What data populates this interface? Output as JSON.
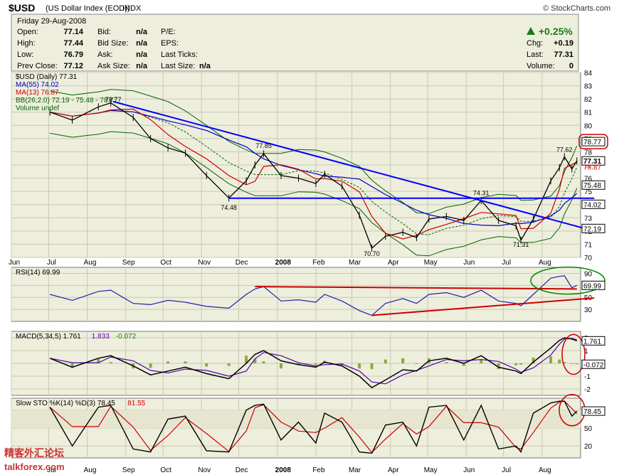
{
  "header": {
    "symbol": "$USD",
    "name": "(US Dollar Index (EOD))",
    "exchange": "INDX",
    "source": "© StockCharts.com"
  },
  "quote": {
    "date": "Friday   29-Aug-2008",
    "rows": [
      [
        "Open:",
        "77.14",
        "Bid:",
        "n/a",
        "P/E:",
        ""
      ],
      [
        "High:",
        "77.44",
        "Bid Size:",
        "n/a",
        "EPS:",
        ""
      ],
      [
        "Low:",
        "76.79",
        "Ask:",
        "n/a",
        "Last Ticks:",
        ""
      ],
      [
        "Prev Close:",
        "77.12",
        "Ask Size:",
        "n/a",
        "Last Size:",
        "n/a"
      ]
    ],
    "change_pct": "+0.25%",
    "right": [
      [
        "Chg:",
        "+0.19"
      ],
      [
        "Last:",
        "77.31"
      ],
      [
        "Volume:",
        "0"
      ]
    ],
    "up_color": "#1a7a1a"
  },
  "watermark": {
    "chinese": "精客外汇论坛",
    "url": "talkforex.com"
  },
  "chart_data": [
    {
      "type": "line",
      "panel": "price",
      "legend": [
        {
          "text": "$USD (Daily) 77.31",
          "color": "#000000"
        },
        {
          "text": "MA(55) 74.02",
          "color": "#0000cc"
        },
        {
          "text": "MA(13) 76.87",
          "color": "#cc0000"
        },
        {
          "text": "BB(26,2.0) 72.19 - 75.48 - 78.77",
          "color": "#006600"
        },
        {
          "text": "Volume undef",
          "color": "#006600"
        }
      ],
      "ylim": [
        70,
        84
      ],
      "y_ticks": [
        "70",
        "71",
        "72",
        "73",
        "74",
        "75",
        "76",
        "77",
        "78",
        "79",
        "80",
        "81",
        "82",
        "83",
        "84"
      ],
      "x_labels": [
        "Jun",
        "Jul",
        "Aug",
        "Sep",
        "Oct",
        "Nov",
        "Dec",
        "2008",
        "Feb",
        "Mar",
        "Apr",
        "May",
        "Jun",
        "Jul",
        "Aug"
      ],
      "price_series": [
        {
          "date": "2007-07-02",
          "value": 81.0
        },
        {
          "date": "2007-07-20",
          "value": 80.4
        },
        {
          "date": "2007-08-10",
          "value": 81.4
        },
        {
          "date": "2007-08-20",
          "value": 81.7
        },
        {
          "date": "2007-09-07",
          "value": 80.6
        },
        {
          "date": "2007-09-21",
          "value": 79.0
        },
        {
          "date": "2007-10-05",
          "value": 78.3
        },
        {
          "date": "2007-10-19",
          "value": 77.9
        },
        {
          "date": "2007-11-05",
          "value": 76.2
        },
        {
          "date": "2007-11-23",
          "value": 74.5
        },
        {
          "date": "2007-12-07",
          "value": 75.8
        },
        {
          "date": "2007-12-14",
          "value": 77.0
        },
        {
          "date": "2007-12-21",
          "value": 77.85
        },
        {
          "date": "2008-01-04",
          "value": 76.2
        },
        {
          "date": "2008-01-18",
          "value": 76.0
        },
        {
          "date": "2008-02-01",
          "value": 75.6
        },
        {
          "date": "2008-02-08",
          "value": 76.3
        },
        {
          "date": "2008-02-22",
          "value": 75.4
        },
        {
          "date": "2008-03-07",
          "value": 73.2
        },
        {
          "date": "2008-03-17",
          "value": 70.7
        },
        {
          "date": "2008-03-28",
          "value": 71.6
        },
        {
          "date": "2008-04-11",
          "value": 71.9
        },
        {
          "date": "2008-04-22",
          "value": 71.5
        },
        {
          "date": "2008-05-02",
          "value": 72.9
        },
        {
          "date": "2008-05-16",
          "value": 73.1
        },
        {
          "date": "2008-05-30",
          "value": 72.8
        },
        {
          "date": "2008-06-13",
          "value": 74.31
        },
        {
          "date": "2008-06-27",
          "value": 72.8
        },
        {
          "date": "2008-07-11",
          "value": 72.4
        },
        {
          "date": "2008-07-15",
          "value": 71.31
        },
        {
          "date": "2008-07-25",
          "value": 72.9
        },
        {
          "date": "2008-08-08",
          "value": 75.8
        },
        {
          "date": "2008-08-15",
          "value": 76.8
        },
        {
          "date": "2008-08-19",
          "value": 77.62
        },
        {
          "date": "2008-08-25",
          "value": 76.7
        },
        {
          "date": "2008-08-29",
          "value": 77.31
        }
      ],
      "annotations": [
        {
          "text": "78.77",
          "date": "2007-08-22",
          "value": 81.8
        },
        {
          "text": "77.85",
          "date": "2007-12-21",
          "value": 78.3
        },
        {
          "text": "74.48",
          "date": "2007-11-23",
          "value": 73.6
        },
        {
          "text": "74.31",
          "date": "2008-06-13",
          "value": 74.7
        },
        {
          "text": "70.70",
          "date": "2008-03-17",
          "value": 70.1
        },
        {
          "text": "71.31",
          "date": "2008-07-15",
          "value": 70.8
        },
        {
          "text": "77.62",
          "date": "2008-08-19",
          "value": 78.0
        }
      ],
      "price_labels": [
        {
          "text": "78.77",
          "value": 78.77,
          "border": "#000000"
        },
        {
          "text": "77.31",
          "value": 77.31,
          "border": "#000000"
        },
        {
          "text": "76.87",
          "value": 76.87,
          "border": "none"
        },
        {
          "text": "75.48",
          "value": 75.48,
          "border": "#000000"
        },
        {
          "text": "74.02",
          "value": 74.02,
          "border": "#000000"
        },
        {
          "text": "72.19",
          "value": 72.19,
          "border": "#000000"
        }
      ],
      "trendlines": [
        {
          "from_date": "2007-08-22",
          "from_value": 81.8,
          "to_date": "2008-09-12",
          "to_value": 72.0,
          "color": "#0000ff"
        },
        {
          "from_date": "2007-11-23",
          "from_value": 74.48,
          "to_date": "2008-09-12",
          "to_value": 74.48,
          "color": "#0000ff"
        }
      ]
    },
    {
      "type": "line",
      "panel": "rsi",
      "legend": [
        {
          "text": "RSI(14) 69.99",
          "color": "#000000"
        }
      ],
      "ylim": [
        10,
        100
      ],
      "y_ticks": [
        "30",
        "50",
        "70",
        "90"
      ],
      "current_label": "69.99",
      "current_value": 69.99,
      "series": [
        {
          "date": "2007-07-02",
          "value": 55
        },
        {
          "date": "2007-07-20",
          "value": 45
        },
        {
          "date": "2007-08-10",
          "value": 60
        },
        {
          "date": "2007-08-20",
          "value": 62
        },
        {
          "date": "2007-09-07",
          "value": 40
        },
        {
          "date": "2007-09-21",
          "value": 38
        },
        {
          "date": "2007-10-05",
          "value": 45
        },
        {
          "date": "2007-10-19",
          "value": 42
        },
        {
          "date": "2007-11-05",
          "value": 35
        },
        {
          "date": "2007-11-23",
          "value": 32
        },
        {
          "date": "2007-12-07",
          "value": 55
        },
        {
          "date": "2007-12-14",
          "value": 64
        },
        {
          "date": "2007-12-21",
          "value": 68
        },
        {
          "date": "2008-01-04",
          "value": 44
        },
        {
          "date": "2008-01-18",
          "value": 46
        },
        {
          "date": "2008-02-01",
          "value": 42
        },
        {
          "date": "2008-02-08",
          "value": 55
        },
        {
          "date": "2008-02-22",
          "value": 44
        },
        {
          "date": "2008-03-07",
          "value": 28
        },
        {
          "date": "2008-03-17",
          "value": 20
        },
        {
          "date": "2008-03-28",
          "value": 40
        },
        {
          "date": "2008-04-11",
          "value": 48
        },
        {
          "date": "2008-04-22",
          "value": 40
        },
        {
          "date": "2008-05-02",
          "value": 55
        },
        {
          "date": "2008-05-16",
          "value": 58
        },
        {
          "date": "2008-05-30",
          "value": 50
        },
        {
          "date": "2008-06-13",
          "value": 62
        },
        {
          "date": "2008-06-27",
          "value": 44
        },
        {
          "date": "2008-07-11",
          "value": 40
        },
        {
          "date": "2008-07-15",
          "value": 36
        },
        {
          "date": "2008-07-25",
          "value": 55
        },
        {
          "date": "2008-08-08",
          "value": 82
        },
        {
          "date": "2008-08-15",
          "value": 85
        },
        {
          "date": "2008-08-19",
          "value": 86
        },
        {
          "date": "2008-08-25",
          "value": 66
        },
        {
          "date": "2008-08-29",
          "value": 69.99
        }
      ],
      "trendlines": [
        {
          "from_date": "2007-12-14",
          "from_value": 68,
          "to_date": "2008-08-29",
          "to_value": 64,
          "color": "#cc0000"
        },
        {
          "from_date": "2008-03-17",
          "from_value": 20,
          "to_date": "2008-09-12",
          "to_value": 49,
          "color": "#cc0000"
        }
      ]
    },
    {
      "type": "line",
      "panel": "macd",
      "legend": [
        {
          "text": "MACD(5,34,5) 1.761",
          "color": "#000000"
        },
        {
          "text": "1.833",
          "color": "#5500aa"
        },
        {
          "text": "-0.072",
          "color": "#008800"
        }
      ],
      "ylim": [
        -2.5,
        2.5
      ],
      "y_ticks": [
        "-2",
        "-1",
        "0",
        "1",
        "2"
      ],
      "current_labels": [
        {
          "text": "1.761",
          "value": 1.761
        },
        {
          "text": "-0.072",
          "value": -0.072
        }
      ],
      "series": [
        {
          "date": "2007-07-02",
          "value": 0.4
        },
        {
          "date": "2007-07-20",
          "value": -0.3
        },
        {
          "date": "2007-08-10",
          "value": 0.4
        },
        {
          "date": "2007-08-20",
          "value": 0.6
        },
        {
          "date": "2007-09-07",
          "value": -0.2
        },
        {
          "date": "2007-09-21",
          "value": -0.9
        },
        {
          "date": "2007-10-05",
          "value": -0.6
        },
        {
          "date": "2007-10-19",
          "value": -0.3
        },
        {
          "date": "2007-11-05",
          "value": -0.8
        },
        {
          "date": "2007-11-23",
          "value": -1.2
        },
        {
          "date": "2007-12-07",
          "value": 0.0
        },
        {
          "date": "2007-12-14",
          "value": 0.7
        },
        {
          "date": "2007-12-21",
          "value": 1.0
        },
        {
          "date": "2008-01-04",
          "value": 0.2
        },
        {
          "date": "2008-01-18",
          "value": -0.1
        },
        {
          "date": "2008-02-01",
          "value": -0.3
        },
        {
          "date": "2008-02-08",
          "value": 0.1
        },
        {
          "date": "2008-02-22",
          "value": -0.2
        },
        {
          "date": "2008-03-07",
          "value": -1.0
        },
        {
          "date": "2008-03-17",
          "value": -1.9
        },
        {
          "date": "2008-03-28",
          "value": -1.3
        },
        {
          "date": "2008-04-11",
          "value": -0.5
        },
        {
          "date": "2008-04-22",
          "value": -0.6
        },
        {
          "date": "2008-05-02",
          "value": 0.2
        },
        {
          "date": "2008-05-16",
          "value": 0.4
        },
        {
          "date": "2008-05-30",
          "value": 0.0
        },
        {
          "date": "2008-06-13",
          "value": 0.6
        },
        {
          "date": "2008-06-27",
          "value": -0.3
        },
        {
          "date": "2008-07-11",
          "value": -0.6
        },
        {
          "date": "2008-07-15",
          "value": -0.8
        },
        {
          "date": "2008-07-25",
          "value": 0.1
        },
        {
          "date": "2008-08-08",
          "value": 1.2
        },
        {
          "date": "2008-08-15",
          "value": 1.8
        },
        {
          "date": "2008-08-19",
          "value": 2.0
        },
        {
          "date": "2008-08-25",
          "value": 1.9
        },
        {
          "date": "2008-08-29",
          "value": 1.761
        }
      ]
    },
    {
      "type": "line",
      "panel": "stochastic",
      "legend": [
        {
          "text": "Slow STO %K(14) %D(3) 78.45",
          "color": "#000000"
        },
        {
          "text": "81.55",
          "color": "#cc0000"
        }
      ],
      "ylim": [
        0,
        100
      ],
      "y_ticks": [
        "20",
        "50",
        "80"
      ],
      "current_label": "78.45",
      "current_value": 78.45,
      "series": [
        {
          "date": "2007-07-02",
          "value": 85
        },
        {
          "date": "2007-07-20",
          "value": 20
        },
        {
          "date": "2007-08-10",
          "value": 85
        },
        {
          "date": "2007-08-20",
          "value": 88
        },
        {
          "date": "2007-09-07",
          "value": 15
        },
        {
          "date": "2007-09-21",
          "value": 10
        },
        {
          "date": "2007-10-05",
          "value": 65
        },
        {
          "date": "2007-10-19",
          "value": 70
        },
        {
          "date": "2007-11-05",
          "value": 12
        },
        {
          "date": "2007-11-23",
          "value": 10
        },
        {
          "date": "2007-12-07",
          "value": 80
        },
        {
          "date": "2007-12-14",
          "value": 88
        },
        {
          "date": "2007-12-21",
          "value": 90
        },
        {
          "date": "2008-01-04",
          "value": 30
        },
        {
          "date": "2008-01-18",
          "value": 60
        },
        {
          "date": "2008-02-01",
          "value": 25
        },
        {
          "date": "2008-02-08",
          "value": 75
        },
        {
          "date": "2008-02-22",
          "value": 60
        },
        {
          "date": "2008-03-07",
          "value": 10
        },
        {
          "date": "2008-03-17",
          "value": 8
        },
        {
          "date": "2008-03-28",
          "value": 55
        },
        {
          "date": "2008-04-11",
          "value": 60
        },
        {
          "date": "2008-04-22",
          "value": 20
        },
        {
          "date": "2008-05-02",
          "value": 85
        },
        {
          "date": "2008-05-16",
          "value": 88
        },
        {
          "date": "2008-05-30",
          "value": 30
        },
        {
          "date": "2008-06-13",
          "value": 88
        },
        {
          "date": "2008-06-27",
          "value": 15
        },
        {
          "date": "2008-07-11",
          "value": 20
        },
        {
          "date": "2008-07-15",
          "value": 10
        },
        {
          "date": "2008-07-25",
          "value": 75
        },
        {
          "date": "2008-08-08",
          "value": 92
        },
        {
          "date": "2008-08-15",
          "value": 95
        },
        {
          "date": "2008-08-19",
          "value": 95
        },
        {
          "date": "2008-08-25",
          "value": 70
        },
        {
          "date": "2008-08-29",
          "value": 78.45
        }
      ]
    }
  ],
  "colors": {
    "panel_bg": "#eeeedd",
    "price": "#000000",
    "ma55": "#0000cc",
    "ma13": "#cc0000",
    "bollinger": "#006600",
    "trendline": "#0000ff",
    "rsi": "#2222aa",
    "macd": "#000000",
    "signal": "#5500aa",
    "histogram": "#88aa44",
    "stoch_k": "#000000",
    "stoch_d": "#cc0000",
    "highlight_red": "#cc0000",
    "highlight_green": "#008800",
    "watermark": "#cc3333"
  }
}
